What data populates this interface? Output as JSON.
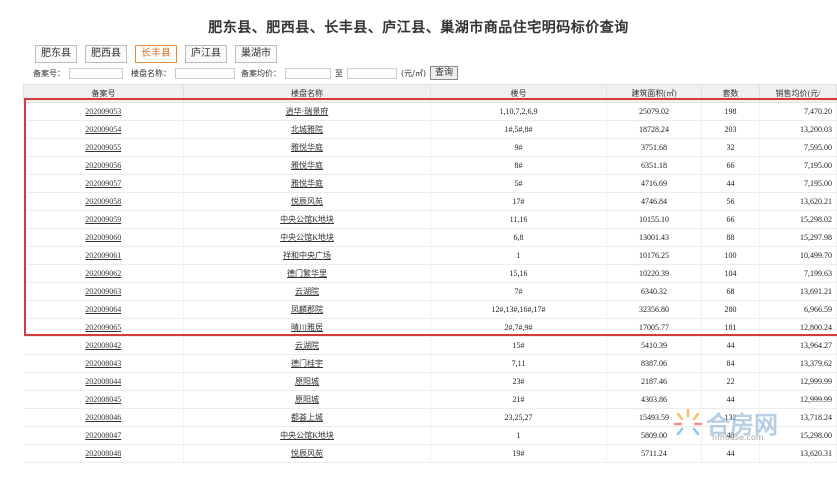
{
  "title": "肥东县、肥西县、长丰县、庐江县、巢湖市商品住宅明码标价查询",
  "tabs": [
    "肥东县",
    "肥西县",
    "长丰县",
    "庐江县",
    "巢湖市"
  ],
  "active_tab": "长丰县",
  "filter": {
    "record_label": "备案号：",
    "project_label": "楼盘名称：",
    "price_label": "备案均价：",
    "to_label": "至",
    "unit_label": "(元/㎡)",
    "search_label": "查询"
  },
  "columns": [
    "备案号",
    "楼盘名称",
    "楼号",
    "建筑面积(㎡)",
    "套数",
    "销售均价(元/"
  ],
  "rows": [
    [
      "202009053",
      "逍华·瑞景府",
      "1,10,7,2,6,9",
      "25079.02",
      "198",
      "7,470.20"
    ],
    [
      "202009054",
      "北城雅院",
      "1#,5#,8#",
      "18728.24",
      "203",
      "13,200.03"
    ],
    [
      "202009055",
      "雅悦华庭",
      "9#",
      "3751.68",
      "32",
      "7,595.00"
    ],
    [
      "202009056",
      "雅悦华庭",
      "8#",
      "6351.18",
      "66",
      "7,195.00"
    ],
    [
      "202009057",
      "雅悦华庭",
      "5#",
      "4716.69",
      "44",
      "7,195.00"
    ],
    [
      "202009058",
      "悦辰风苑",
      "17#",
      "4746.84",
      "56",
      "13,620.21"
    ],
    [
      "202009059",
      "中央公馆K地块",
      "11,16",
      "10155.10",
      "66",
      "15,298.02"
    ],
    [
      "202009060",
      "中央公馆K地块",
      "6,8",
      "13001.43",
      "88",
      "15,297.98"
    ],
    [
      "202009061",
      "祥和中央广场",
      "1",
      "10176.25",
      "100",
      "10,499.70"
    ],
    [
      "202009062",
      "德门繁华里",
      "15,16",
      "10220.39",
      "104",
      "7,199.63"
    ],
    [
      "202009063",
      "云湖院",
      "7#",
      "6340.32",
      "68",
      "13,691.21"
    ],
    [
      "202009064",
      "凤麟郡院",
      "12#,13#,16#,17#",
      "32356.80",
      "280",
      "6,966.59"
    ],
    [
      "202009065",
      "晴川雅居",
      "2#,7#,9#",
      "17005.77",
      "181",
      "12,800.24"
    ],
    [
      "202008042",
      "云湖院",
      "15#",
      "5410.39",
      "44",
      "13,964.27"
    ],
    [
      "202008043",
      "德门桂宇",
      "7,11",
      "8387.06",
      "84",
      "13,379.62"
    ],
    [
      "202008044",
      "原阳城",
      "23#",
      "2187.46",
      "22",
      "12,999.99"
    ],
    [
      "202008045",
      "原阳城",
      "21#",
      "4303.86",
      "44",
      "12,999.99"
    ],
    [
      "202008046",
      "都荟上城",
      "23,25,27",
      "15493.59",
      "132",
      "13,718.24"
    ],
    [
      "202008047",
      "中央公馆K地块",
      "1",
      "5809.00",
      "40",
      "15,298.00"
    ],
    [
      "202008048",
      "悦辰风苑",
      "19#",
      "5711.24",
      "44",
      "13,620.31"
    ]
  ],
  "watermark": {
    "text": "合房网",
    "sub": "hfhouse.com"
  }
}
